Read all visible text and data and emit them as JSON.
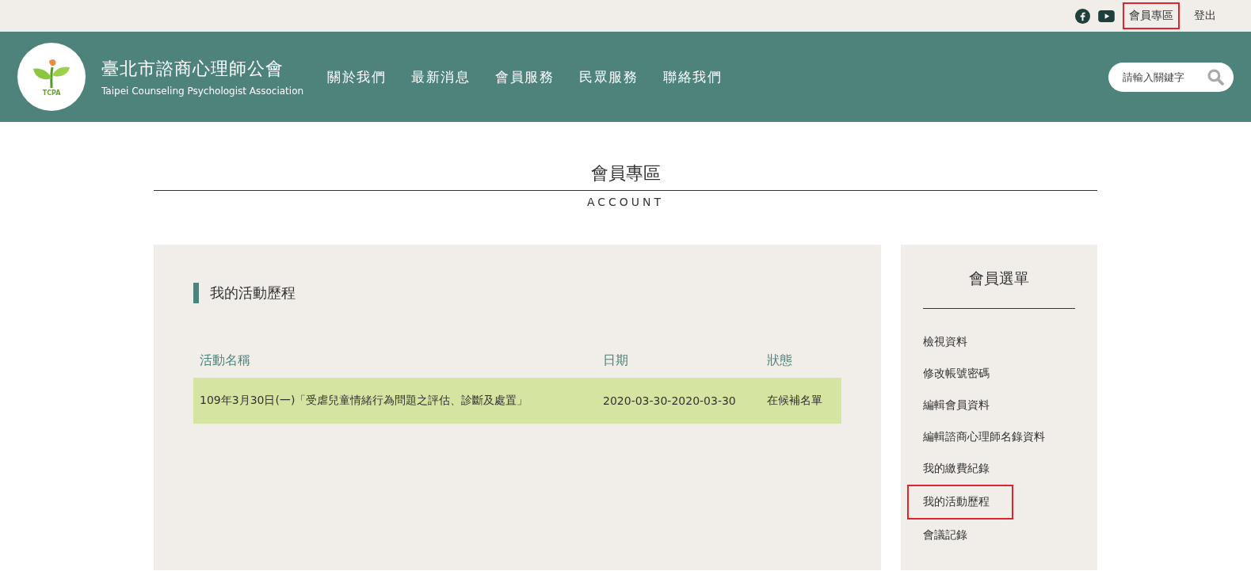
{
  "top_links": [
    {
      "label": "會員專區",
      "highlighted": true
    },
    {
      "label": "登出",
      "highlighted": false
    }
  ],
  "header": {
    "logo_text": "TCPA",
    "title": "臺北市諮商心理師公會",
    "subtitle": "Taipei Counseling Psychologist Association",
    "nav": [
      "關於我們",
      "最新消息",
      "會員服務",
      "民眾服務",
      "聯絡我們"
    ],
    "search": {
      "placeholder": "請輸入關鍵字"
    }
  },
  "page_title": {
    "title": "會員專區",
    "subtitle": "ACCOUNT"
  },
  "section": {
    "title": "我的活動歷程",
    "table": {
      "columns": [
        "活動名稱",
        "日期",
        "狀態"
      ],
      "rows": [
        [
          "109年3月30日(一)「受虐兒童情緒行為問題之評估、診斷及處置」",
          "2020-03-30-2020-03-30",
          "在候補名單"
        ]
      ]
    }
  },
  "sidebar": {
    "title": "會員選單",
    "items": [
      {
        "label": "檢視資料",
        "highlighted": false
      },
      {
        "label": "修改帳號密碼",
        "highlighted": false
      },
      {
        "label": "編輯會員資料",
        "highlighted": false
      },
      {
        "label": "編輯諮商心理師名錄資料",
        "highlighted": false
      },
      {
        "label": "我的繳費紀錄",
        "highlighted": false
      },
      {
        "label": "我的活動歷程",
        "highlighted": true
      },
      {
        "label": "會議記錄",
        "highlighted": false
      }
    ]
  }
}
